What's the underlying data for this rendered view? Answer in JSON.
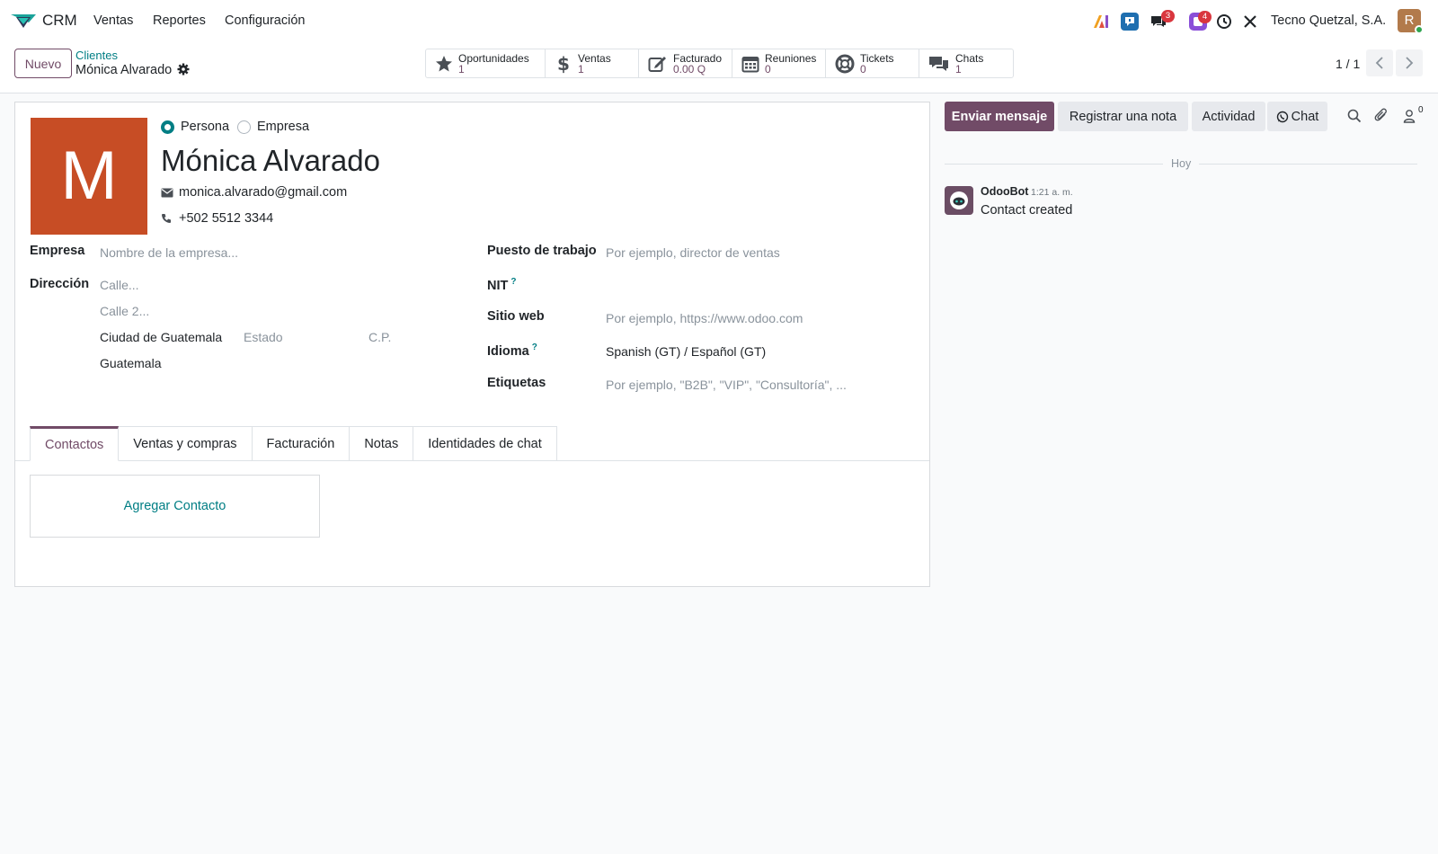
{
  "app": {
    "name": "CRM",
    "menu": [
      "Ventas",
      "Reportes",
      "Configuración"
    ],
    "company": "Tecno Quetzal, S.A.",
    "user_initial": "R",
    "badges": {
      "messages": "3",
      "activities": "4"
    }
  },
  "control_panel": {
    "new_button": "Nuevo",
    "breadcrumb_parent": "Clientes",
    "breadcrumb_current": "Mónica Alvarado",
    "pager": "1 / 1",
    "smart_buttons": [
      {
        "label": "Oportunidades",
        "value": "1",
        "icon": "star-icon"
      },
      {
        "label": "Ventas",
        "value": "1",
        "icon": "dollar-icon"
      },
      {
        "label": "Facturado",
        "value": "0.00 Q",
        "icon": "pencil-square-icon"
      },
      {
        "label": "Reuniones",
        "value": "0",
        "icon": "calendar-icon"
      },
      {
        "label": "Tickets",
        "value": "0",
        "icon": "life-ring-icon"
      },
      {
        "label": "Chats",
        "value": "1",
        "icon": "comments-icon"
      }
    ]
  },
  "form": {
    "avatar_letter": "M",
    "avatar_color": "#c74d25",
    "type_person": "Persona",
    "type_company": "Empresa",
    "selected_type": "Persona",
    "name": "Mónica Alvarado",
    "email": "monica.alvarado@gmail.com",
    "phone": "+502 5512 3344",
    "labels": {
      "company": "Empresa",
      "address": "Dirección",
      "job": "Puesto de trabajo",
      "nit": "NIT",
      "website": "Sitio web",
      "language": "Idioma",
      "tags": "Etiquetas",
      "help_mark": "?"
    },
    "placeholders": {
      "company": "Nombre de la empresa...",
      "street": "Calle...",
      "street2": "Calle 2...",
      "state": "Estado",
      "zip": "C.P.",
      "job": "Por ejemplo, director de ventas",
      "website": "Por ejemplo, https://www.odoo.com",
      "tags": "Por ejemplo, \"B2B\", \"VIP\", \"Consultoría\", ..."
    },
    "values": {
      "city": "Ciudad de Guatemala",
      "country": "Guatemala",
      "language": "Spanish (GT) / Español (GT)"
    },
    "tabs": [
      "Contactos",
      "Ventas y compras",
      "Facturación",
      "Notas",
      "Identidades de chat"
    ],
    "active_tab": "Contactos",
    "add_contact": "Agregar Contacto"
  },
  "chatter": {
    "send_message": "Enviar mensaje",
    "log_note": "Registrar una nota",
    "activity": "Actividad",
    "chat": "Chat",
    "followers_count": "0",
    "date_separator": "Hoy",
    "message": {
      "author": "OdooBot",
      "time": "1:21 a. m.",
      "body": "Contact created"
    }
  },
  "colors": {
    "brand": "#714b67",
    "link": "#017e84",
    "badge": "#d9363e"
  }
}
